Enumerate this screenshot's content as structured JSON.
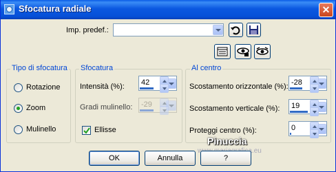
{
  "window": {
    "title": "Sfocatura radiale"
  },
  "preset": {
    "label": "Imp. predef.:",
    "value": ""
  },
  "blur_type": {
    "title": "Tipo di sfocatura",
    "options": [
      {
        "label": "Rotazione",
        "selected": false
      },
      {
        "label": "Zoom",
        "selected": true
      },
      {
        "label": "Mulinello",
        "selected": false
      }
    ]
  },
  "blur": {
    "title": "Sfocatura",
    "intensity_label": "Intensità (%):",
    "intensity_value": "42",
    "twirl_label": "Gradi mulinello:",
    "twirl_value": "-29",
    "ellipse_label": "Ellisse",
    "ellipse_checked": true
  },
  "center": {
    "title": "Al centro",
    "h_offset_label": "Scostamento orizzontale (%):",
    "h_offset_value": "-28",
    "v_offset_label": "Scostamento verticale (%):",
    "v_offset_value": "19",
    "protect_label": "Proteggi centro (%):",
    "protect_value": "0"
  },
  "buttons": {
    "ok": "OK",
    "cancel": "Annulla",
    "help": "?"
  },
  "watermark": {
    "name": "Pinuccia",
    "site": "www.mariagrafica.eu"
  }
}
